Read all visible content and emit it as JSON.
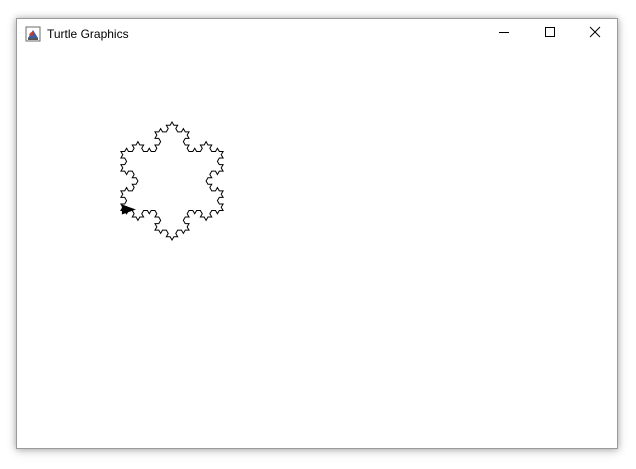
{
  "window": {
    "title": "Turtle Graphics",
    "icon": "java-cup-icon",
    "controls": {
      "minimize_icon": "minimize-icon",
      "maximize_icon": "maximize-icon",
      "close_icon": "close-icon"
    }
  },
  "canvas": {
    "background": "#ffffff",
    "stroke_color": "#000000",
    "drawing": "koch-snowflake",
    "recursion_depth": 3,
    "turtle_heading": "east"
  }
}
